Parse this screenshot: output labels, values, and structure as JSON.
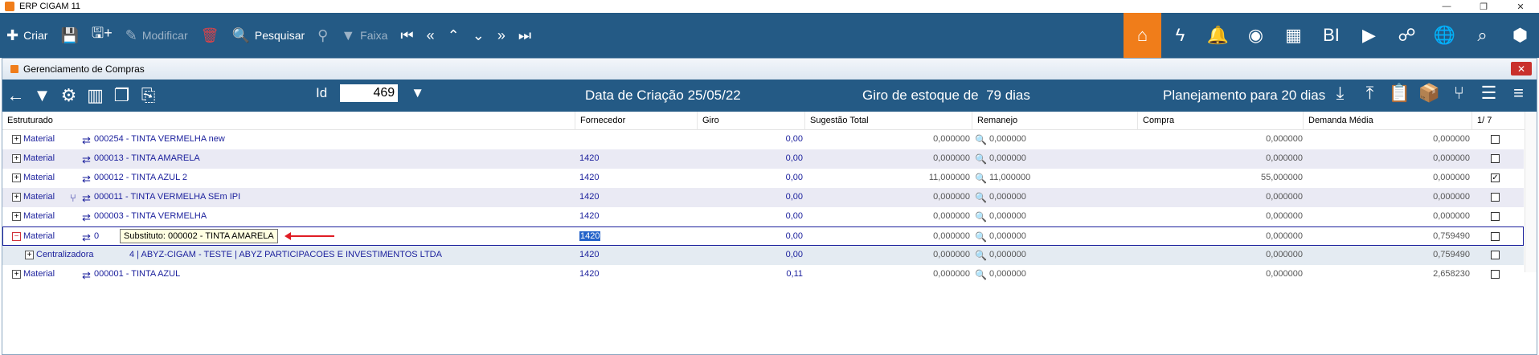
{
  "window": {
    "title": "ERP CIGAM 11"
  },
  "toolbar": {
    "criar": "Criar",
    "modificar": "Modificar",
    "pesquisar": "Pesquisar",
    "faixa": "Faixa",
    "bi": "BI"
  },
  "subwindow": {
    "title": "Gerenciamento de Compras"
  },
  "filterbar": {
    "id_label": "Id",
    "id_value": "469",
    "data_criacao": "Data de Criação 25/05/22",
    "giro_label": "Giro de estoque de",
    "giro_value": "79 dias",
    "planejamento": "Planejamento para 20 dias"
  },
  "table": {
    "headers": {
      "estruturado": "Estruturado",
      "fornecedor": "Fornecedor",
      "giro": "Giro",
      "sugestao": "Sugestão Total",
      "remanejo": "Remanejo",
      "compra": "Compra",
      "demanda": "Demanda Média",
      "pages": "1/ 7"
    },
    "rows": [
      {
        "type": "Material",
        "code": "000254 - TINTA VERMELHA new",
        "fornecedor": "",
        "giro": "0,00",
        "sugestao": "0,000000",
        "remanejo": "0,000000",
        "compra": "0,000000",
        "demanda": "0,000000",
        "checked": ""
      },
      {
        "type": "Material",
        "code": "000013 - TINTA AMARELA",
        "fornecedor": "1420",
        "giro": "0,00",
        "sugestao": "0,000000",
        "remanejo": "0,000000",
        "compra": "0,000000",
        "demanda": "0,000000",
        "checked": ""
      },
      {
        "type": "Material",
        "code": "000012 - TINTA AZUL 2",
        "fornecedor": "1420",
        "giro": "0,00",
        "sugestao": "11,000000",
        "remanejo": "11,000000",
        "compra": "55,000000",
        "demanda": "0,000000",
        "checked": "✓"
      },
      {
        "type": "Material",
        "code": "000011 - TINTA VERMELHA SEm IPI",
        "fornecedor": "1420",
        "giro": "0,00",
        "sugestao": "0,000000",
        "remanejo": "0,000000",
        "compra": "0,000000",
        "demanda": "0,000000",
        "checked": ""
      },
      {
        "type": "Material",
        "code": "000003 - TINTA VERMELHA",
        "fornecedor": "1420",
        "giro": "0,00",
        "sugestao": "0,000000",
        "remanejo": "0,000000",
        "compra": "0,000000",
        "demanda": "0,000000",
        "checked": ""
      },
      {
        "type": "Material",
        "code": "0",
        "fornecedor": "1420",
        "giro": "0,00",
        "sugestao": "0,000000",
        "remanejo": "0,000000",
        "compra": "0,000000",
        "demanda": "0,759490",
        "checked": "",
        "tooltip": "Substituto: 000002 - TINTA AMARELA"
      },
      {
        "type": "Centralizadora",
        "code": "4   | ABYZ-CIGAM - TESTE | ABYZ PARTICIPACOES E INVESTIMENTOS LTDA",
        "fornecedor": "1420",
        "giro": "0,00",
        "sugestao": "0,000000",
        "remanejo": "0,000000",
        "compra": "0,000000",
        "demanda": "0,759490",
        "checked": ""
      },
      {
        "type": "Material",
        "code": "000001 - TINTA AZUL",
        "fornecedor": "1420",
        "giro": "0,11",
        "sugestao": "0,000000",
        "remanejo": "0,000000",
        "compra": "0,000000",
        "demanda": "2,658230",
        "checked": ""
      }
    ]
  },
  "colors": {
    "toolbar": "#245a85",
    "accent": "#f07d1a",
    "link": "#1a1f9c"
  }
}
